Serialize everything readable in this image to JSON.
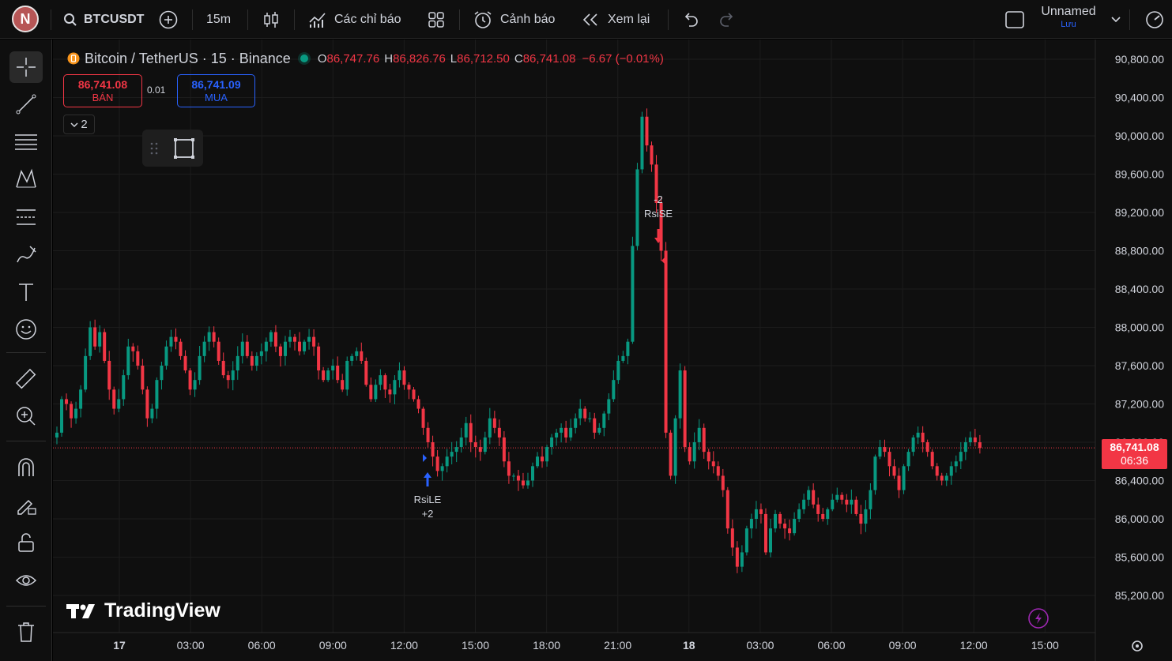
{
  "avatar": {
    "letter": "N"
  },
  "toolbar": {
    "symbol": "BTCUSDT",
    "interval": "15m",
    "indicators_label": "Các chỉ báo",
    "alerts_label": "Cảnh báo",
    "replay_label": "Xem lại",
    "layout_name": "Unnamed",
    "save_label": "Lưu"
  },
  "legend": {
    "title": "Bitcoin / TetherUS · 15 · Binance",
    "o_key": "O",
    "o_val": "86,747.76",
    "h_key": "H",
    "h_val": "86,826.76",
    "l_key": "L",
    "l_val": "86,712.50",
    "c_key": "C",
    "c_val": "86,741.08",
    "change": "−6.67 (−0.01%)"
  },
  "trade": {
    "sell_price": "86,741.08",
    "sell_label": "BÁN",
    "spread": "0.01",
    "buy_price": "86,741.09",
    "buy_label": "MUA",
    "indicator_count": "2"
  },
  "signals": {
    "long_name": "RsiLE",
    "long_qty": "+2",
    "short_name": "RsiSE",
    "short_qty": "-2"
  },
  "price_tag": {
    "price": "86,741.08",
    "countdown": "06:36"
  },
  "brand": {
    "name": "TradingView"
  },
  "colors": {
    "up": "#089981",
    "down": "#f23645",
    "accent": "#2962ff"
  },
  "chart_data": {
    "type": "candlestick",
    "x_tick_labels": [
      "17",
      "03:00",
      "06:00",
      "09:00",
      "12:00",
      "15:00",
      "18:00",
      "21:00",
      "18",
      "03:00",
      "06:00",
      "09:00",
      "12:00",
      "15:00"
    ],
    "y_tick_labels": [
      "90,800.00",
      "90,400.00",
      "90,000.00",
      "89,600.00",
      "89,200.00",
      "88,800.00",
      "88,400.00",
      "88,000.00",
      "87,600.00",
      "87,200.00",
      "86,800.00",
      "86,400.00",
      "86,000.00",
      "85,600.00",
      "85,200.00"
    ],
    "ylim": [
      84950,
      91000
    ],
    "last_price": 86741.08,
    "grid": true,
    "closes": [
      86900,
      87250,
      87200,
      87050,
      87150,
      87350,
      87700,
      88000,
      87800,
      87950,
      87650,
      87350,
      87150,
      87250,
      87500,
      87800,
      87750,
      87600,
      87350,
      87050,
      87150,
      87450,
      87600,
      87800,
      87900,
      87850,
      87700,
      87550,
      87350,
      87450,
      87700,
      87850,
      87950,
      87850,
      87650,
      87500,
      87450,
      87550,
      87700,
      87850,
      87700,
      87600,
      87700,
      87750,
      87850,
      87950,
      87800,
      87700,
      87850,
      87900,
      87850,
      87750,
      87850,
      87900,
      87800,
      87550,
      87450,
      87550,
      87600,
      87450,
      87350,
      87650,
      87700,
      87750,
      87650,
      87400,
      87250,
      87400,
      87500,
      87350,
      87300,
      87450,
      87550,
      87400,
      87350,
      87250,
      87150,
      86950,
      86800,
      86650,
      86500,
      86550,
      86650,
      86700,
      86750,
      86850,
      87000,
      86800,
      86750,
      86700,
      86850,
      87050,
      86950,
      86850,
      86600,
      86450,
      86450,
      86400,
      86350,
      86400,
      86550,
      86650,
      86600,
      86750,
      86850,
      86900,
      86950,
      86850,
      86950,
      87050,
      87150,
      87050,
      87050,
      86900,
      86950,
      87100,
      87250,
      87450,
      87650,
      87700,
      87850,
      88850,
      89650,
      90200,
      89900,
      89700,
      89300,
      88800,
      86900,
      86450,
      87050,
      87550,
      86750,
      86600,
      86800,
      86950,
      86700,
      86600,
      86550,
      86450,
      86300,
      85900,
      85700,
      85500,
      85650,
      85900,
      86000,
      86100,
      86050,
      85650,
      85900,
      86050,
      85950,
      85900,
      85850,
      86000,
      86100,
      86200,
      86300,
      86150,
      86050,
      86000,
      86100,
      86200,
      86250,
      86200,
      86150,
      86200,
      86050,
      85950,
      86100,
      86300,
      86650,
      86750,
      86700,
      86550,
      86450,
      86300,
      86550,
      86700,
      86850,
      86900,
      86800,
      86700,
      86550,
      86450,
      86400,
      86450,
      86550,
      86600,
      86700,
      86800,
      86850,
      86800,
      86741
    ]
  }
}
